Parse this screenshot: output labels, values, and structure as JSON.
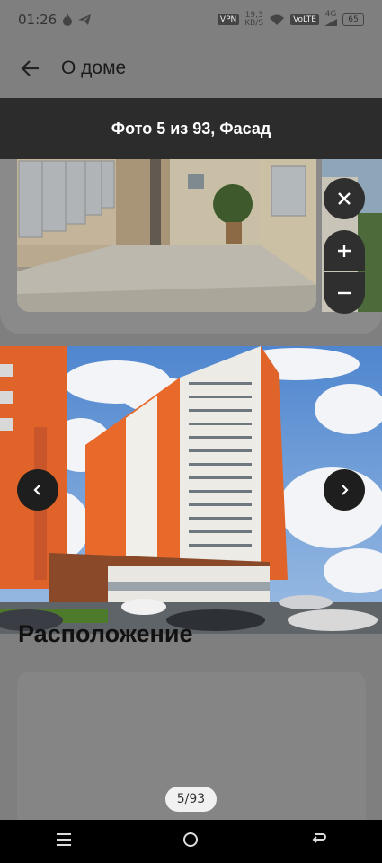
{
  "status_bar": {
    "time": "01:26",
    "speed_value": "19,3",
    "speed_unit": "KB/S",
    "vpn": "VPN",
    "volte": "VoLTE",
    "network": "4G",
    "battery": "65"
  },
  "app_bar": {
    "title": "О доме"
  },
  "viewer": {
    "caption": "Фото 5 из 93, Фасад",
    "counter": "5/93"
  },
  "page": {
    "section_heading": "Расположение"
  },
  "icons": {
    "back": "arrow-left-icon",
    "close": "close-icon",
    "zoom_in": "plus-icon",
    "zoom_out": "minus-icon",
    "prev": "chevron-left-icon",
    "next": "chevron-right-icon"
  },
  "colors": {
    "overlay_dark": "#2c2c2c",
    "facade_orange": "#e8692a",
    "sky": "#6f9fd8"
  }
}
